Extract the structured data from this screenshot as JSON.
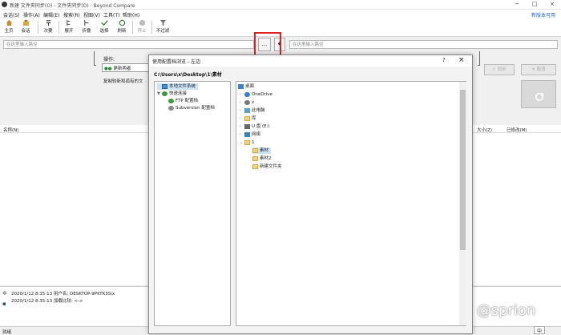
{
  "window": {
    "title": "新建 文件夹同步(O) - 文件夹同步(O) - Beyond Compare"
  },
  "menu": [
    "会话(S)",
    "操作(A)",
    "编辑(E)",
    "搜索(R)",
    "视图(V)",
    "工具(T)",
    "帮助(H)"
  ],
  "new_version_link": "新版本可用",
  "toolbar": [
    {
      "label": "主页",
      "icon": "home-icon"
    },
    {
      "label": "会话",
      "icon": "session-icon"
    },
    {
      "label": "次要",
      "icon": "minor-icon"
    },
    {
      "label": "展开",
      "icon": "expand-icon"
    },
    {
      "label": "折叠",
      "icon": "collapse-icon"
    },
    {
      "label": "选择",
      "icon": "select-icon"
    },
    {
      "label": "刷新",
      "icon": "refresh-icon"
    },
    {
      "label": "停止",
      "icon": "stop-icon"
    },
    {
      "label": "不过滤",
      "icon": "filter-icon"
    }
  ],
  "left_path_placeholder": "在这里输入路径",
  "right_path_placeholder": "在这里输入路径",
  "browse_button": "...",
  "operation": {
    "label": "操作:",
    "value": "更新两者",
    "description": "复制较新和孤有的文"
  },
  "right_buttons": {
    "sync_label": "同步",
    "cancel_label": "取消"
  },
  "left_columns": {
    "name": "名称(N)"
  },
  "right_columns": {
    "size": "大小(Z)",
    "modified": "已修改(M)"
  },
  "log": [
    "2020/1/12 8:35:13  用户名: DESKTOP-9PKTK3S\\x",
    "2020/1/12 8:35:13  加载比较: <->"
  ],
  "status": "就绪",
  "dialog": {
    "title": "使用配置档浏览 - 左边",
    "help": "?",
    "close": "×",
    "current_path": "C:\\Users\\x\\Desktop\\1\\素材",
    "left_tree": [
      {
        "label": "本地文件系统",
        "indent": 0,
        "selected": true
      },
      {
        "label": "快速连接",
        "indent": 0,
        "expanded": true
      },
      {
        "label": "FTP 配置档",
        "indent": 1
      },
      {
        "label": "Subversion 配置档",
        "indent": 1
      }
    ],
    "right_tree": [
      {
        "label": "桌面",
        "indent": 0
      },
      {
        "label": "OneDrive",
        "indent": 1
      },
      {
        "label": "x",
        "indent": 1
      },
      {
        "label": "此电脑",
        "indent": 1
      },
      {
        "label": "库",
        "indent": 1
      },
      {
        "label": "U 盘 (E:)",
        "indent": 1
      },
      {
        "label": "网络",
        "indent": 1
      },
      {
        "label": "1",
        "indent": 1,
        "expanded": true
      },
      {
        "label": "素材",
        "indent": 2,
        "selected": true
      },
      {
        "label": "素材2",
        "indent": 2
      },
      {
        "label": "新建文件夹",
        "indent": 2
      }
    ]
  },
  "watermark": "知乎 @sprion",
  "ime": "中"
}
